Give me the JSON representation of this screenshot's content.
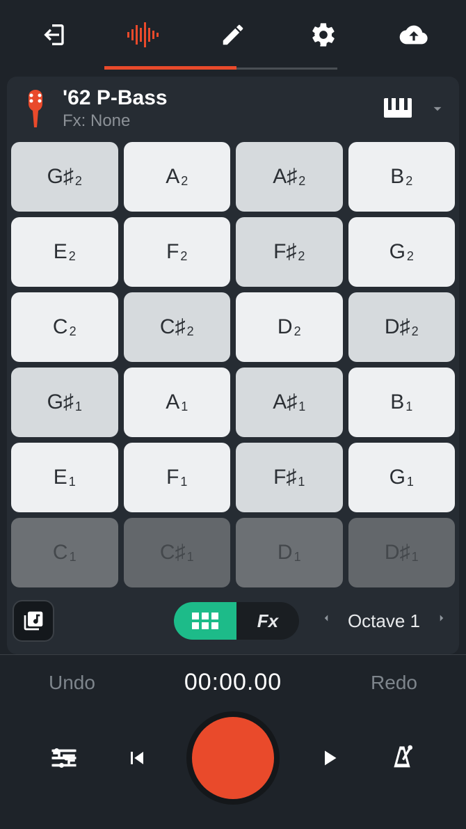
{
  "nav": {
    "active_index": 1
  },
  "instrument": {
    "title": "'62 P-Bass",
    "fx_label": "Fx: None"
  },
  "pads": [
    {
      "note": "G",
      "acc": "♯",
      "oct": "2",
      "sharp": true,
      "dim": false
    },
    {
      "note": "A",
      "acc": "",
      "oct": "2",
      "sharp": false,
      "dim": false
    },
    {
      "note": "A",
      "acc": "♯",
      "oct": "2",
      "sharp": true,
      "dim": false
    },
    {
      "note": "B",
      "acc": "",
      "oct": "2",
      "sharp": false,
      "dim": false
    },
    {
      "note": "E",
      "acc": "",
      "oct": "2",
      "sharp": false,
      "dim": false
    },
    {
      "note": "F",
      "acc": "",
      "oct": "2",
      "sharp": false,
      "dim": false
    },
    {
      "note": "F",
      "acc": "♯",
      "oct": "2",
      "sharp": true,
      "dim": false
    },
    {
      "note": "G",
      "acc": "",
      "oct": "2",
      "sharp": false,
      "dim": false
    },
    {
      "note": "C",
      "acc": "",
      "oct": "2",
      "sharp": false,
      "dim": false
    },
    {
      "note": "C",
      "acc": "♯",
      "oct": "2",
      "sharp": true,
      "dim": false
    },
    {
      "note": "D",
      "acc": "",
      "oct": "2",
      "sharp": false,
      "dim": false
    },
    {
      "note": "D",
      "acc": "♯",
      "oct": "2",
      "sharp": true,
      "dim": false
    },
    {
      "note": "G",
      "acc": "♯",
      "oct": "1",
      "sharp": true,
      "dim": false
    },
    {
      "note": "A",
      "acc": "",
      "oct": "1",
      "sharp": false,
      "dim": false
    },
    {
      "note": "A",
      "acc": "♯",
      "oct": "1",
      "sharp": true,
      "dim": false
    },
    {
      "note": "B",
      "acc": "",
      "oct": "1",
      "sharp": false,
      "dim": false
    },
    {
      "note": "E",
      "acc": "",
      "oct": "1",
      "sharp": false,
      "dim": false
    },
    {
      "note": "F",
      "acc": "",
      "oct": "1",
      "sharp": false,
      "dim": false
    },
    {
      "note": "F",
      "acc": "♯",
      "oct": "1",
      "sharp": true,
      "dim": false
    },
    {
      "note": "G",
      "acc": "",
      "oct": "1",
      "sharp": false,
      "dim": false
    },
    {
      "note": "C",
      "acc": "",
      "oct": "1",
      "sharp": false,
      "dim": true
    },
    {
      "note": "C",
      "acc": "♯",
      "oct": "1",
      "sharp": true,
      "dim": true
    },
    {
      "note": "D",
      "acc": "",
      "oct": "1",
      "sharp": false,
      "dim": true
    },
    {
      "note": "D",
      "acc": "♯",
      "oct": "1",
      "sharp": true,
      "dim": true
    }
  ],
  "segment": {
    "fx_label": "Fx"
  },
  "octave": {
    "label": "Octave 1"
  },
  "undo_label": "Undo",
  "redo_label": "Redo",
  "timer": "00:00.00"
}
